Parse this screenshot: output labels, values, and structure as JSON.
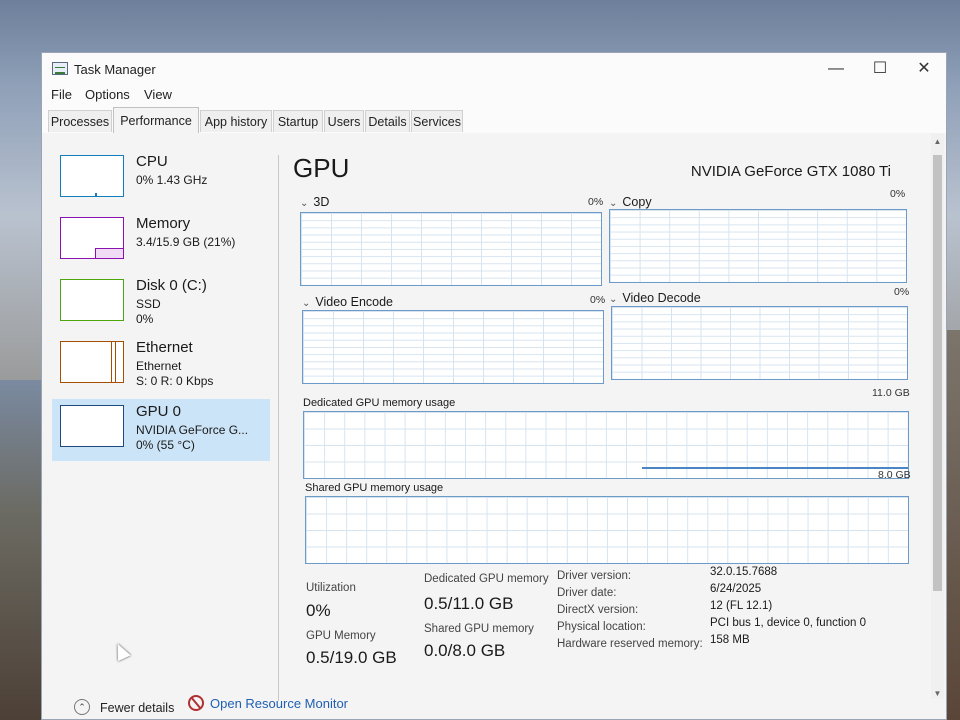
{
  "window": {
    "title": "Task Manager",
    "controls": {
      "minimize": "—",
      "maximize": "☐",
      "close": "✕"
    }
  },
  "menu": [
    "File",
    "Options",
    "View"
  ],
  "tabs": [
    "Processes",
    "Performance",
    "App history",
    "Startup",
    "Users",
    "Details",
    "Services"
  ],
  "active_tab": "Performance",
  "sidebar": {
    "items": [
      {
        "name": "CPU",
        "line1": "0% 1.43 GHz",
        "line2": "",
        "accent": "#117dbb"
      },
      {
        "name": "Memory",
        "line1": "3.4/15.9 GB (21%)",
        "line2": "",
        "accent": "#8b12ae"
      },
      {
        "name": "Disk 0 (C:)",
        "line1": "SSD",
        "line2": "0%",
        "accent": "#4da60c"
      },
      {
        "name": "Ethernet",
        "line1": "Ethernet",
        "line2": "S: 0 R: 0 Kbps",
        "accent": "#a74f01"
      },
      {
        "name": "GPU 0",
        "line1": "NVIDIA GeForce G...",
        "line2": "0% (55 °C)",
        "accent": "#1c4a80",
        "selected": true
      }
    ]
  },
  "gpu": {
    "title": "GPU",
    "model": "NVIDIA GeForce GTX 1080 Ti",
    "engines": [
      {
        "label": "3D",
        "pct": "0%"
      },
      {
        "label": "Copy",
        "pct": "0%"
      },
      {
        "label": "Video Encode",
        "pct": "0%"
      },
      {
        "label": "Video Decode",
        "pct": "0%"
      }
    ],
    "dedicated": {
      "label": "Dedicated GPU memory usage",
      "max": "11.0 GB"
    },
    "shared": {
      "label": "Shared GPU memory usage",
      "max": "8.0 GB"
    },
    "stats": {
      "utilization_label": "Utilization",
      "utilization": "0%",
      "gpu_memory_label": "GPU Memory",
      "gpu_memory": "0.5/19.0 GB",
      "dedicated_label": "Dedicated GPU memory",
      "dedicated": "0.5/11.0 GB",
      "shared_label": "Shared GPU memory",
      "shared": "0.0/8.0 GB"
    },
    "info": [
      {
        "key": "Driver version:",
        "value": "32.0.15.7688"
      },
      {
        "key": "Driver date:",
        "value": "6/24/2025"
      },
      {
        "key": "DirectX version:",
        "value": "12 (FL 12.1)"
      },
      {
        "key": "Physical location:",
        "value": "PCI bus 1, device 0, function 0"
      },
      {
        "key": "Hardware reserved memory:",
        "value": "158 MB"
      }
    ]
  },
  "footer": {
    "fewer_details": "Fewer details",
    "resource_monitor": "Open Resource Monitor"
  }
}
